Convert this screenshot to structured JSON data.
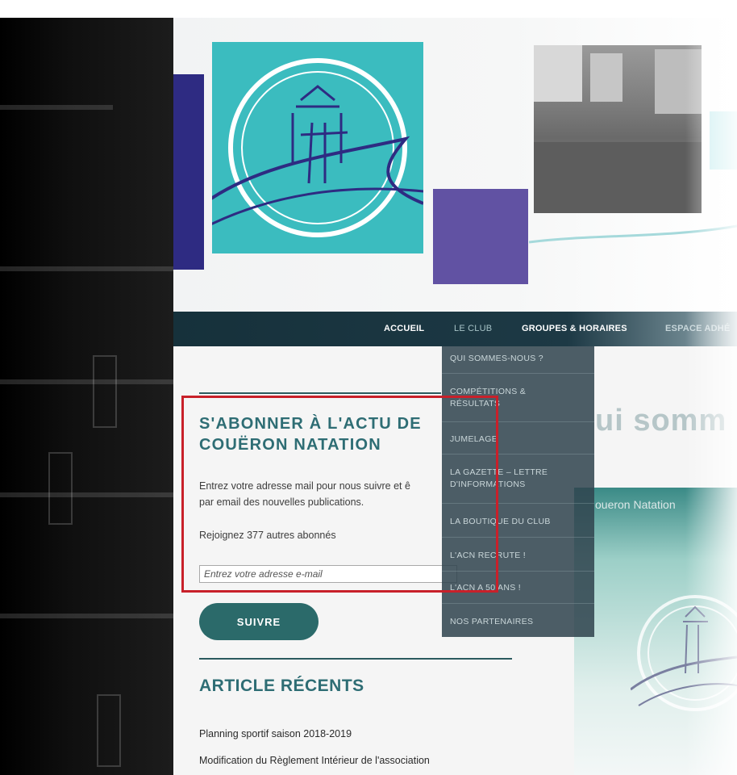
{
  "nav": {
    "items": [
      {
        "label": "ACCUEIL"
      },
      {
        "label": "LE CLUB"
      },
      {
        "label": "GROUPES & HORAIRES"
      },
      {
        "label": "ESPACE ADHÉ"
      }
    ]
  },
  "dropdown": {
    "items": [
      {
        "label": "QUI SOMMES-NOUS ?"
      },
      {
        "label": "COMPÉTITIONS & RÉSULTATS"
      },
      {
        "label": "JUMELAGE"
      },
      {
        "label": "LA GAZETTE – LETTRE D'INFORMATIONS"
      },
      {
        "label": "LA BOUTIQUE DU CLUB"
      },
      {
        "label": "L'ACN RECRUTE !"
      },
      {
        "label": "L'ACN A 50 ANS !"
      },
      {
        "label": "NOS PARTENAIRES"
      }
    ]
  },
  "subscribe": {
    "title": "S'ABONNER À L'ACTU DE COUËRON NATATION",
    "description_line1": "Entrez votre adresse mail pour nous suivre et ê",
    "description_line2": "par email des nouvelles publications.",
    "subscribers": "Rejoignez 377 autres abonnés",
    "email_placeholder": "Entrez votre adresse e-mail",
    "button_label": "SUIVRE"
  },
  "recent": {
    "title": "ARTICLE RÉCENTS",
    "articles": [
      {
        "label": "Planning sportif saison 2018-2019"
      },
      {
        "label": "Modification du Règlement Intérieur de l'association"
      }
    ]
  },
  "page": {
    "heading": "ui somm",
    "caption": "oueron Natation"
  },
  "colors": {
    "teal": "#3bbcbf",
    "navy": "#2e2b82",
    "purple": "#6152a3",
    "accent_text": "#2e6d74",
    "nav_bg": "#16313b",
    "highlight": "#c8202a"
  }
}
